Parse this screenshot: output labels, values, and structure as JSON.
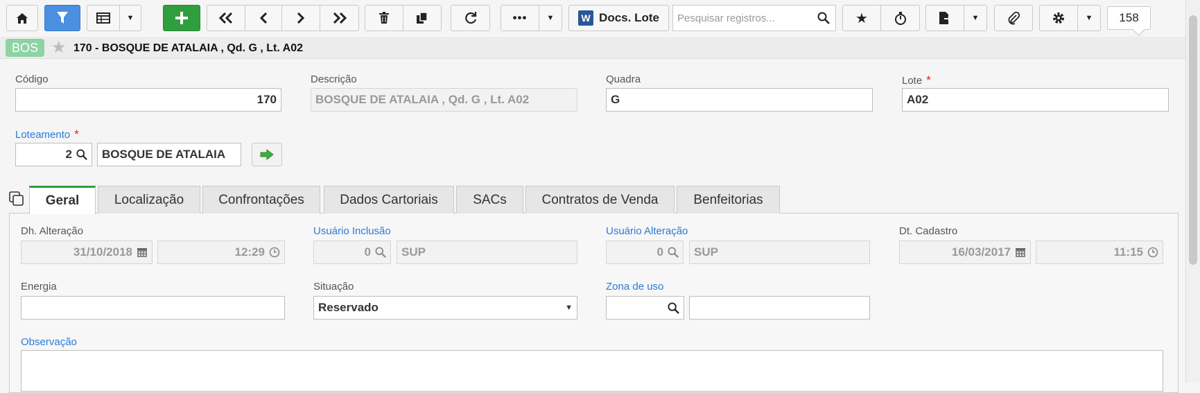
{
  "toolbar": {
    "docs_label": "Docs. Lote",
    "word_letter": "W",
    "search_placeholder": "Pesquisar registros...",
    "record_count": "158"
  },
  "record": {
    "badge": "BOS",
    "title": "170 - BOSQUE DE ATALAIA , Qd. G , Lt. A02"
  },
  "form": {
    "codigo": {
      "label": "Código",
      "value": "170"
    },
    "descricao": {
      "label": "Descrição",
      "value": "BOSQUE DE ATALAIA ,  Qd. G ,  Lt. A02"
    },
    "quadra": {
      "label": "Quadra",
      "value": "G"
    },
    "lote": {
      "label": "Lote",
      "value": "A02",
      "required": "*"
    },
    "loteamento": {
      "label": "Loteamento",
      "required": "*",
      "code": "2",
      "name": "BOSQUE DE ATALAIA"
    }
  },
  "tabs": [
    {
      "label": "Geral"
    },
    {
      "label": "Localização"
    },
    {
      "label": "Confrontações"
    },
    {
      "label": "Dados Cartoriais"
    },
    {
      "label": "SACs"
    },
    {
      "label": "Contratos de Venda"
    },
    {
      "label": "Benfeitorias"
    }
  ],
  "geral": {
    "dh_alteracao": {
      "label": "Dh. Alteração",
      "date": "31/10/2018",
      "time": "12:29"
    },
    "usuario_inclusao": {
      "label": "Usuário Inclusão",
      "code": "0",
      "name": "SUP"
    },
    "usuario_alteracao": {
      "label": "Usuário Alteração",
      "code": "0",
      "name": "SUP"
    },
    "dt_cadastro": {
      "label": "Dt. Cadastro",
      "date": "16/03/2017",
      "time": "11:15"
    },
    "energia": {
      "label": "Energia",
      "value": ""
    },
    "situacao": {
      "label": "Situação",
      "value": "Reservado"
    },
    "zona_de_uso": {
      "label": "Zona de uso",
      "code": "",
      "name": ""
    },
    "observacao": {
      "label": "Observação",
      "value": ""
    }
  },
  "colors": {
    "filter_active": "#4a8fe0",
    "add_button": "#2f9e3f",
    "badge": "#8dd3a4",
    "link_label": "#2a7bd5",
    "required": "#d22222"
  }
}
